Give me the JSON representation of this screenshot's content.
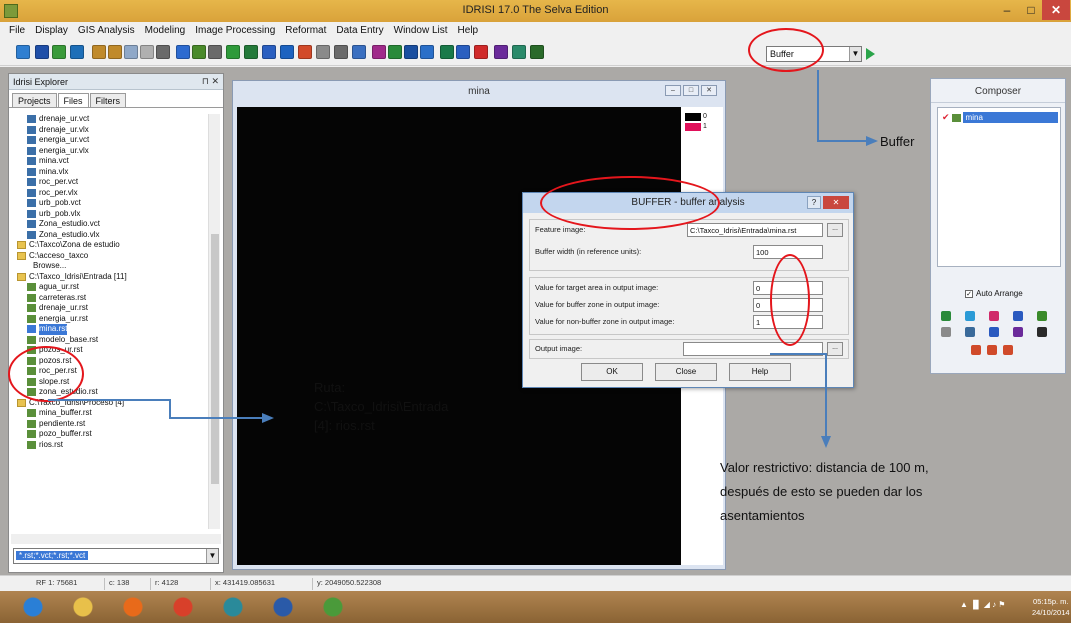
{
  "window": {
    "title": "IDRISI 17.0   The Selva Edition",
    "min_glyph": "–",
    "max_glyph": "□",
    "close_glyph": "✕"
  },
  "menu": [
    "File",
    "Display",
    "GIS Analysis",
    "Modeling",
    "Image Processing",
    "Reformat",
    "Data Entry",
    "Window List",
    "Help"
  ],
  "toolbar": {
    "module_value": "Buffer",
    "icons": [
      {
        "name": "open-icon",
        "color": "#2f7fd1"
      },
      {
        "name": "display-icon",
        "color": "#1f4fa8"
      },
      {
        "name": "composer-icon",
        "color": "#3a9a3a"
      },
      {
        "name": "palette-icon",
        "color": "#1e6fb8"
      },
      {
        "name": "zoom-in-icon",
        "color": "#c08a2b"
      },
      {
        "name": "zoom-out-icon",
        "color": "#c08a2b"
      },
      {
        "name": "window-icon",
        "color": "#8fa8c8"
      },
      {
        "name": "pan-icon",
        "color": "#b0b0b0"
      },
      {
        "name": "measure-icon",
        "color": "#6a6a6a"
      },
      {
        "name": "table-icon",
        "color": "#2d6bd0"
      },
      {
        "name": "grid-icon",
        "color": "#4a8a2a"
      },
      {
        "name": "histogram-icon",
        "color": "#6a6a6a"
      },
      {
        "name": "digitize-icon",
        "color": "#2e9a3a"
      },
      {
        "name": "vector-icon",
        "color": "#247a3a"
      },
      {
        "name": "query-icon",
        "color": "#2a5fc0"
      },
      {
        "name": "database-icon",
        "color": "#1d63c0"
      },
      {
        "name": "add-icon",
        "color": "#d24a2a"
      },
      {
        "name": "edit-icon",
        "color": "#8a8a8a"
      },
      {
        "name": "undo-icon",
        "color": "#6a6a6a"
      },
      {
        "name": "calc-icon",
        "color": "#3a6fc0"
      },
      {
        "name": "chart-icon",
        "color": "#a02a8a"
      },
      {
        "name": "crosshair-icon",
        "color": "#2a8a3a"
      },
      {
        "name": "list-icon",
        "color": "#1a4fa0"
      },
      {
        "name": "layers-icon",
        "color": "#2a6fc8"
      },
      {
        "name": "stats-icon",
        "color": "#1a7a4a"
      },
      {
        "name": "brush-icon",
        "color": "#2a5fc0"
      },
      {
        "name": "erase-icon",
        "color": "#d02a2a"
      },
      {
        "name": "shapes-icon",
        "color": "#6a2a9a"
      },
      {
        "name": "link-icon",
        "color": "#2a8a6a"
      },
      {
        "name": "tool-icon",
        "color": "#2a6a2a"
      }
    ]
  },
  "explorer": {
    "title": "Idrisi Explorer",
    "pin": "⊓ ✕",
    "tabs": [
      "Projects",
      "Files",
      "Filters"
    ],
    "files": [
      {
        "name": "drenaje_ur.vct",
        "kind": "vct"
      },
      {
        "name": "drenaje_ur.vlx",
        "kind": "vct"
      },
      {
        "name": "energia_ur.vct",
        "kind": "vct"
      },
      {
        "name": "energia_ur.vlx",
        "kind": "vct"
      },
      {
        "name": "mina.vct",
        "kind": "vct"
      },
      {
        "name": "mina.vlx",
        "kind": "vct"
      },
      {
        "name": "roc_per.vct",
        "kind": "vct"
      },
      {
        "name": "roc_per.vlx",
        "kind": "vct"
      },
      {
        "name": "urb_pob.vct",
        "kind": "vct"
      },
      {
        "name": "urb_pob.vlx",
        "kind": "vct"
      },
      {
        "name": "Zona_estudio.vct",
        "kind": "vct"
      },
      {
        "name": "Zona_estudio.vlx",
        "kind": "vct"
      },
      {
        "name": "C:\\Taxco\\Zona de estudio",
        "kind": "folder"
      },
      {
        "name": "C:\\acceso_taxco",
        "kind": "folder"
      },
      {
        "name": "Browse...",
        "kind": "text"
      },
      {
        "name": "C:\\Taxco_Idrisi\\Entrada [11]",
        "kind": "folder"
      },
      {
        "name": "agua_ur.rst",
        "kind": "rst"
      },
      {
        "name": "carreteras.rst",
        "kind": "rst"
      },
      {
        "name": "drenaje_ur.rst",
        "kind": "rst"
      },
      {
        "name": "energia_ur.rst",
        "kind": "rst"
      },
      {
        "name": "mina.rst",
        "kind": "rst",
        "selected": true
      },
      {
        "name": "modelo_base.rst",
        "kind": "rst"
      },
      {
        "name": "pozos_ur.rst",
        "kind": "rst"
      },
      {
        "name": "pozos.rst",
        "kind": "rst"
      },
      {
        "name": "roc_per.rst",
        "kind": "rst"
      },
      {
        "name": "slope.rst",
        "kind": "rst"
      },
      {
        "name": "zona_estudio.rst",
        "kind": "rst"
      },
      {
        "name": "C:\\Taxco_Idrisi\\Proceso [4]",
        "kind": "folder"
      },
      {
        "name": "mina_buffer.rst",
        "kind": "rst"
      },
      {
        "name": "pendiente.rst",
        "kind": "rst"
      },
      {
        "name": "pozo_buffer.rst",
        "kind": "rst"
      },
      {
        "name": "rios.rst",
        "kind": "rst"
      }
    ],
    "filter_value": "*.rst;*.vct;*.rst;*.vct"
  },
  "map_window": {
    "title": "mina",
    "legend": [
      {
        "label": "0",
        "color": "#000000"
      },
      {
        "label": "1",
        "color": "#e0105a"
      }
    ]
  },
  "composer": {
    "title": "Composer",
    "layer": "mina",
    "check_glyph": "✔",
    "autostretch_label": "Auto Arrange",
    "autostretch_glyph": "✓"
  },
  "buffer_dialog": {
    "title": "BUFFER - buffer analysis",
    "help_glyph": "?",
    "close_glyph": "✕",
    "feature_image_label": "Feature image:",
    "feature_image_value": "C:\\Taxco_Idrisi\\Entrada\\mina.rst",
    "buffer_width_label": "Buffer width (in reference units):",
    "buffer_width_value": "100",
    "target_label": "Value for target area in output image:",
    "target_value": "0",
    "buffer_zone_label": "Value for buffer zone in output image:",
    "buffer_zone_value": "0",
    "non_buffer_label": "Value for non-buffer zone in output image:",
    "non_buffer_value": "1",
    "output_label": "Output image:",
    "output_value": "",
    "browse_glyph": "...",
    "ok": "OK",
    "close": "Close",
    "help": "Help"
  },
  "annotations": {
    "buffer": "Buffer",
    "ruta_line1": "Ruta:",
    "ruta_line2": "C:\\Taxco_Idrisi\\Entrada",
    "ruta_line3": "[4]: rios.rst",
    "valor_line1": "Valor restrictivo: distancia de 100 m,",
    "valor_line2": "después de esto se pueden dar los",
    "valor_line3": "asentamientos",
    "ellipse_color": "#e4161c",
    "arrow_color": "#4a7ebb"
  },
  "statusbar": {
    "rf": "RF 1: 75681",
    "col": "c: 138",
    "row": "r: 4128",
    "x": "x: 431419.085631",
    "y": "y: 2049050.522308"
  },
  "taskbar": {
    "apps": [
      {
        "name": "ie-icon",
        "color": "#2a7fd6"
      },
      {
        "name": "file-explorer-icon",
        "color": "#e8c04a"
      },
      {
        "name": "firefox-icon",
        "color": "#e86a1a"
      },
      {
        "name": "chrome-icon",
        "color": "#d8402a"
      },
      {
        "name": "idrisi-globe-icon",
        "color": "#2a8a9a"
      },
      {
        "name": "word-icon",
        "color": "#2a5aa8"
      },
      {
        "name": "idrisi-app-icon",
        "color": "#4a9a3a"
      }
    ],
    "tray": "▲  ▐▌ ◢  ♪  ⚑",
    "time": "05:15p. m.",
    "date": "24/10/2014"
  }
}
